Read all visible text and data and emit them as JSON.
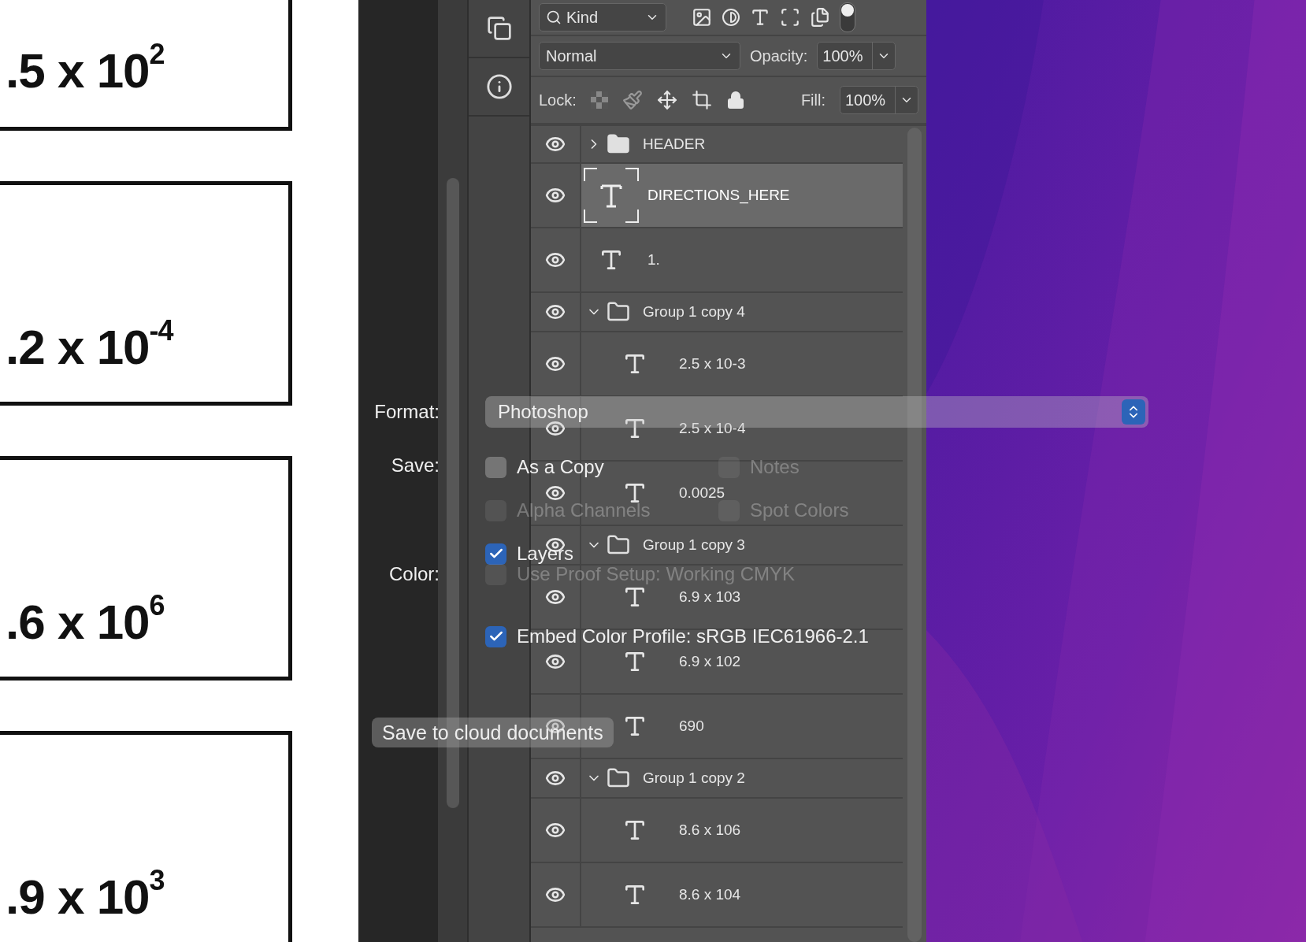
{
  "document": {
    "cards": [
      {
        "number": ".5 x 10$^{2}$"
      },
      {
        "number": ".2 x 10$^{-4}$"
      },
      {
        "number": ".6 x 10$^{6}$"
      },
      {
        "number": ".9 x 10$^{3}$"
      }
    ]
  },
  "layers_panel": {
    "filter": {
      "value": "Kind"
    },
    "blend_mode": "Normal",
    "opacity": {
      "label": "Opacity:",
      "value": "100%"
    },
    "lock_label": "Lock:",
    "fill": {
      "label": "Fill:",
      "value": "100%"
    },
    "layers": [
      {
        "kind": "group",
        "name": "HEADER",
        "visible": true,
        "expanded": false,
        "selected": false
      },
      {
        "kind": "text",
        "name": "DIRECTIONS_HERE",
        "visible": true,
        "selected": true
      },
      {
        "kind": "text",
        "name": "1.",
        "visible": true,
        "selected": false
      },
      {
        "kind": "group",
        "name": "Group 1 copy 4",
        "visible": true,
        "expanded": true,
        "selected": false,
        "children": [
          {
            "kind": "text",
            "name": "2.5 x 10-3",
            "visible": true,
            "selected": false
          },
          {
            "kind": "text",
            "name": "2.5 x 10-4",
            "visible": true,
            "selected": false
          },
          {
            "kind": "text",
            "name": "0.0025",
            "visible": true,
            "selected": false
          }
        ]
      },
      {
        "kind": "group",
        "name": "Group 1 copy 3",
        "visible": true,
        "expanded": true,
        "selected": false,
        "children": [
          {
            "kind": "text",
            "name": "6.9 x 103",
            "visible": true,
            "selected": false
          },
          {
            "kind": "text",
            "name": "6.9 x 102",
            "visible": true,
            "selected": false
          },
          {
            "kind": "text",
            "name": "690",
            "visible": true,
            "selected": false
          }
        ]
      },
      {
        "kind": "group",
        "name": "Group 1 copy 2",
        "visible": true,
        "expanded": true,
        "selected": false,
        "children": [
          {
            "kind": "text",
            "name": "8.6 x 106",
            "visible": true,
            "selected": false
          },
          {
            "kind": "text",
            "name": "8.6 x 104",
            "visible": true,
            "selected": false
          }
        ]
      }
    ]
  },
  "save_dialog": {
    "format": {
      "label": "Format:",
      "value": "Photoshop"
    },
    "save": {
      "label": "Save:",
      "options": [
        {
          "label": "As a Copy",
          "checked": false,
          "disabled": false
        },
        {
          "label": "Notes",
          "checked": false,
          "disabled": true
        },
        {
          "label": "Alpha Channels",
          "checked": false,
          "disabled": true
        },
        {
          "label": "Spot Colors",
          "checked": false,
          "disabled": true
        },
        {
          "label": "Layers",
          "checked": true,
          "disabled": false
        }
      ]
    },
    "color": {
      "label": "Color:",
      "options": [
        {
          "label": "Use Proof Setup:  Working CMYK",
          "checked": false,
          "disabled": true
        },
        {
          "label": "Embed Color Profile:  sRGB IEC61966-2.1",
          "checked": true,
          "disabled": false
        }
      ]
    },
    "cloud_button": "Save to cloud documents"
  }
}
